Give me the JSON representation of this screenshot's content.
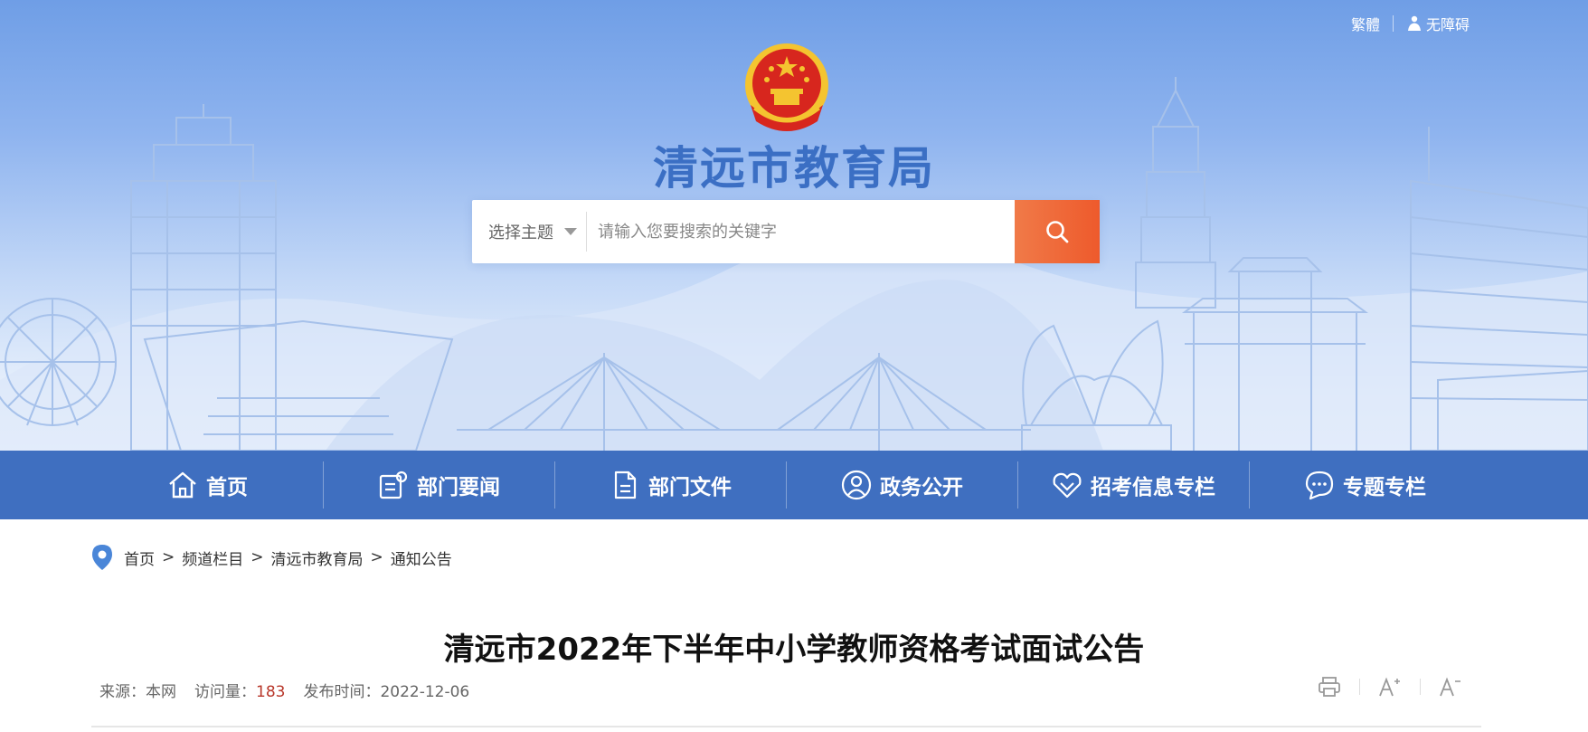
{
  "header": {
    "traditional_label": "繁體",
    "accessibility_label": "无障碍",
    "site_title": "清远市教育局"
  },
  "search": {
    "topic_label": "选择主题",
    "placeholder": "请输入您要搜索的关键字"
  },
  "nav": {
    "items": [
      {
        "label": "首页",
        "icon": "home-icon"
      },
      {
        "label": "部门要闻",
        "icon": "news-icon"
      },
      {
        "label": "部门文件",
        "icon": "document-icon"
      },
      {
        "label": "政务公开",
        "icon": "user-circle-icon"
      },
      {
        "label": "招考信息专栏",
        "icon": "heart-diamond-icon"
      },
      {
        "label": "专题专栏",
        "icon": "chat-bubble-icon"
      }
    ]
  },
  "breadcrumb": {
    "items": [
      "首页",
      "频道栏目",
      "清远市教育局",
      "通知公告"
    ],
    "separator": ">"
  },
  "article": {
    "title": "清远市2022年下半年中小学教师资格考试面试公告",
    "source_label": "来源：",
    "source_value": "本网",
    "views_label": "访问量：",
    "views_value": "183",
    "date_label": "发布时间：",
    "date_value": "2022-12-06"
  },
  "colors": {
    "nav_bg": "#3f6fc0",
    "title_blue": "#3b6fc4",
    "search_button": "#ee5a2c",
    "views_red": "#b8372a"
  }
}
